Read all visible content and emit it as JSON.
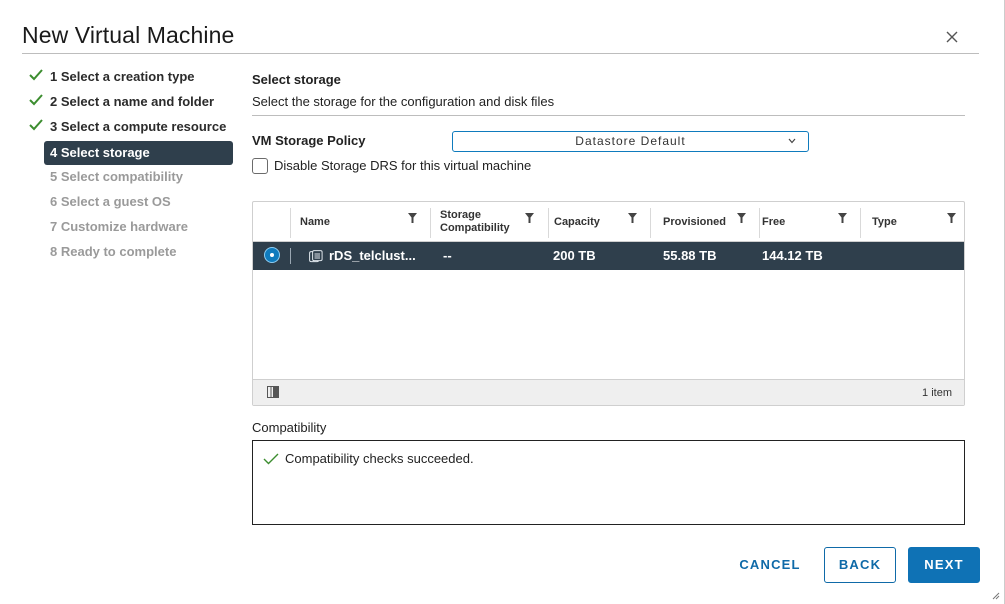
{
  "dialog": {
    "title": "New Virtual Machine"
  },
  "steps": [
    {
      "label": "1 Select a creation type",
      "state": "done"
    },
    {
      "label": "2 Select a name and folder",
      "state": "done"
    },
    {
      "label": "3 Select a compute resource",
      "state": "done"
    },
    {
      "label": "4 Select storage",
      "state": "active"
    },
    {
      "label": "5 Select compatibility",
      "state": "pending"
    },
    {
      "label": "6 Select a guest OS",
      "state": "pending"
    },
    {
      "label": "7 Customize hardware",
      "state": "pending"
    },
    {
      "label": "8 Ready to complete",
      "state": "pending"
    }
  ],
  "section": {
    "title": "Select storage",
    "description": "Select the storage for the configuration and disk files"
  },
  "policy": {
    "label": "VM Storage Policy",
    "value": "Datastore Default"
  },
  "drs": {
    "label": "Disable Storage DRS for this virtual machine",
    "checked": false
  },
  "grid": {
    "columns": [
      {
        "label": "Name"
      },
      {
        "label": "Storage\nCompatibility"
      },
      {
        "label": "Capacity"
      },
      {
        "label": "Provisioned"
      },
      {
        "label": "Free"
      },
      {
        "label": "Type"
      }
    ],
    "rows": [
      {
        "selected": true,
        "name": "rDS_telclust...",
        "compatibility": "--",
        "capacity": "200 TB",
        "provisioned": "55.88 TB",
        "free": "144.12 TB",
        "type": ""
      }
    ],
    "footer_count": "1 item"
  },
  "compatibility": {
    "label": "Compatibility",
    "message": "Compatibility checks succeeded."
  },
  "buttons": {
    "cancel": "CANCEL",
    "back": "BACK",
    "next": "NEXT"
  },
  "colors": {
    "accent": "#0f72b5",
    "selected_row": "#2f3f4c",
    "check_green": "#3c8d2f"
  }
}
